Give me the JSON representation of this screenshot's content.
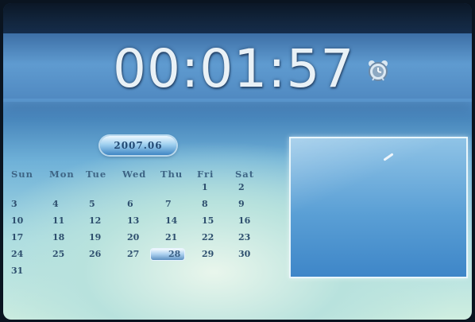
{
  "clock": {
    "time": "00:01:57"
  },
  "alarm": {
    "icon": "alarm-clock-icon"
  },
  "calendar": {
    "month_label": "2007.06",
    "weekdays": [
      "Sun",
      "Mon",
      "Tue",
      "Wed",
      "Thu",
      "Fri",
      "Sat"
    ],
    "weeks": [
      [
        "",
        "",
        "",
        "",
        "",
        "1",
        "2"
      ],
      [
        "3",
        "4",
        "5",
        "6",
        "7",
        "8",
        "9"
      ],
      [
        "10",
        "11",
        "12",
        "13",
        "14",
        "15",
        "16"
      ],
      [
        "17",
        "18",
        "19",
        "20",
        "21",
        "22",
        "23"
      ],
      [
        "24",
        "25",
        "26",
        "27",
        "28",
        "29",
        "30"
      ],
      [
        "31",
        "",
        "",
        "",
        "",
        "",
        ""
      ]
    ],
    "selected_day": "28"
  },
  "photo_frame": {
    "icon": "photo-preview"
  },
  "colors": {
    "header": "#4f88c0",
    "clock_text": "#e9f1f6",
    "calendar_text": "#2e4f6e",
    "highlight": "#a9cfee"
  }
}
